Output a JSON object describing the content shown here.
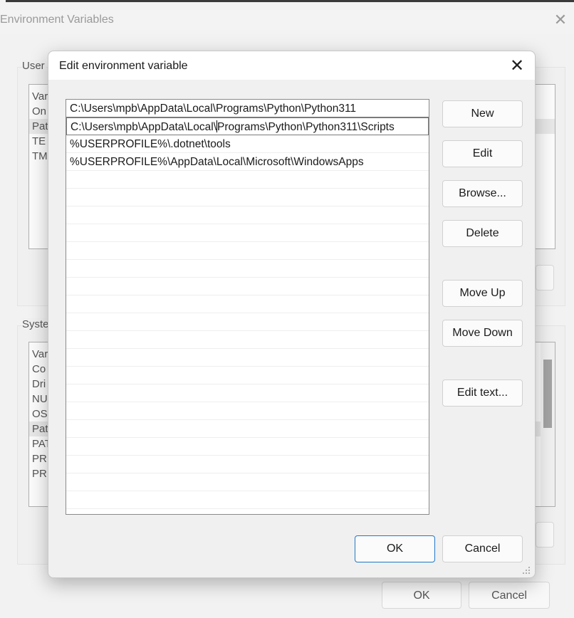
{
  "parent_window": {
    "title": "Environment Variables",
    "close_glyph": "✕",
    "user_group_label": "User",
    "user_list": [
      "Var",
      "On",
      "Pat",
      "TE",
      "TM"
    ],
    "system_group_label": "Syste",
    "system_list": [
      "Var",
      "Co",
      "Dri",
      "NU",
      "OS",
      "Pat",
      "PAT",
      "PR",
      "PR"
    ],
    "ok_label": "OK",
    "cancel_label": "Cancel"
  },
  "dialog": {
    "title": "Edit environment variable",
    "close_glyph": "✕",
    "paths": [
      "C:\\Users\\mpb\\AppData\\Local\\Programs\\Python\\Python311",
      "C:\\Users\\mpb\\AppData\\Local\\",
      "Programs\\Python\\Python311\\Scripts",
      "%USERPROFILE%\\.dotnet\\tools",
      "%USERPROFILE%\\AppData\\Local\\Microsoft\\WindowsApps"
    ],
    "buttons": {
      "new": "New",
      "edit": "Edit",
      "browse": "Browse...",
      "delete": "Delete",
      "move_up": "Move Up",
      "move_down": "Move Down",
      "edit_text": "Edit text...",
      "ok": "OK",
      "cancel": "Cancel"
    }
  },
  "icons": {
    "close": "close-icon",
    "resize_grip": "resize-grip-icon"
  },
  "colors": {
    "accent_border": "#1f78c8",
    "window_bg": "#f0f0f0",
    "dialog_titlebar": "#ffffff"
  }
}
